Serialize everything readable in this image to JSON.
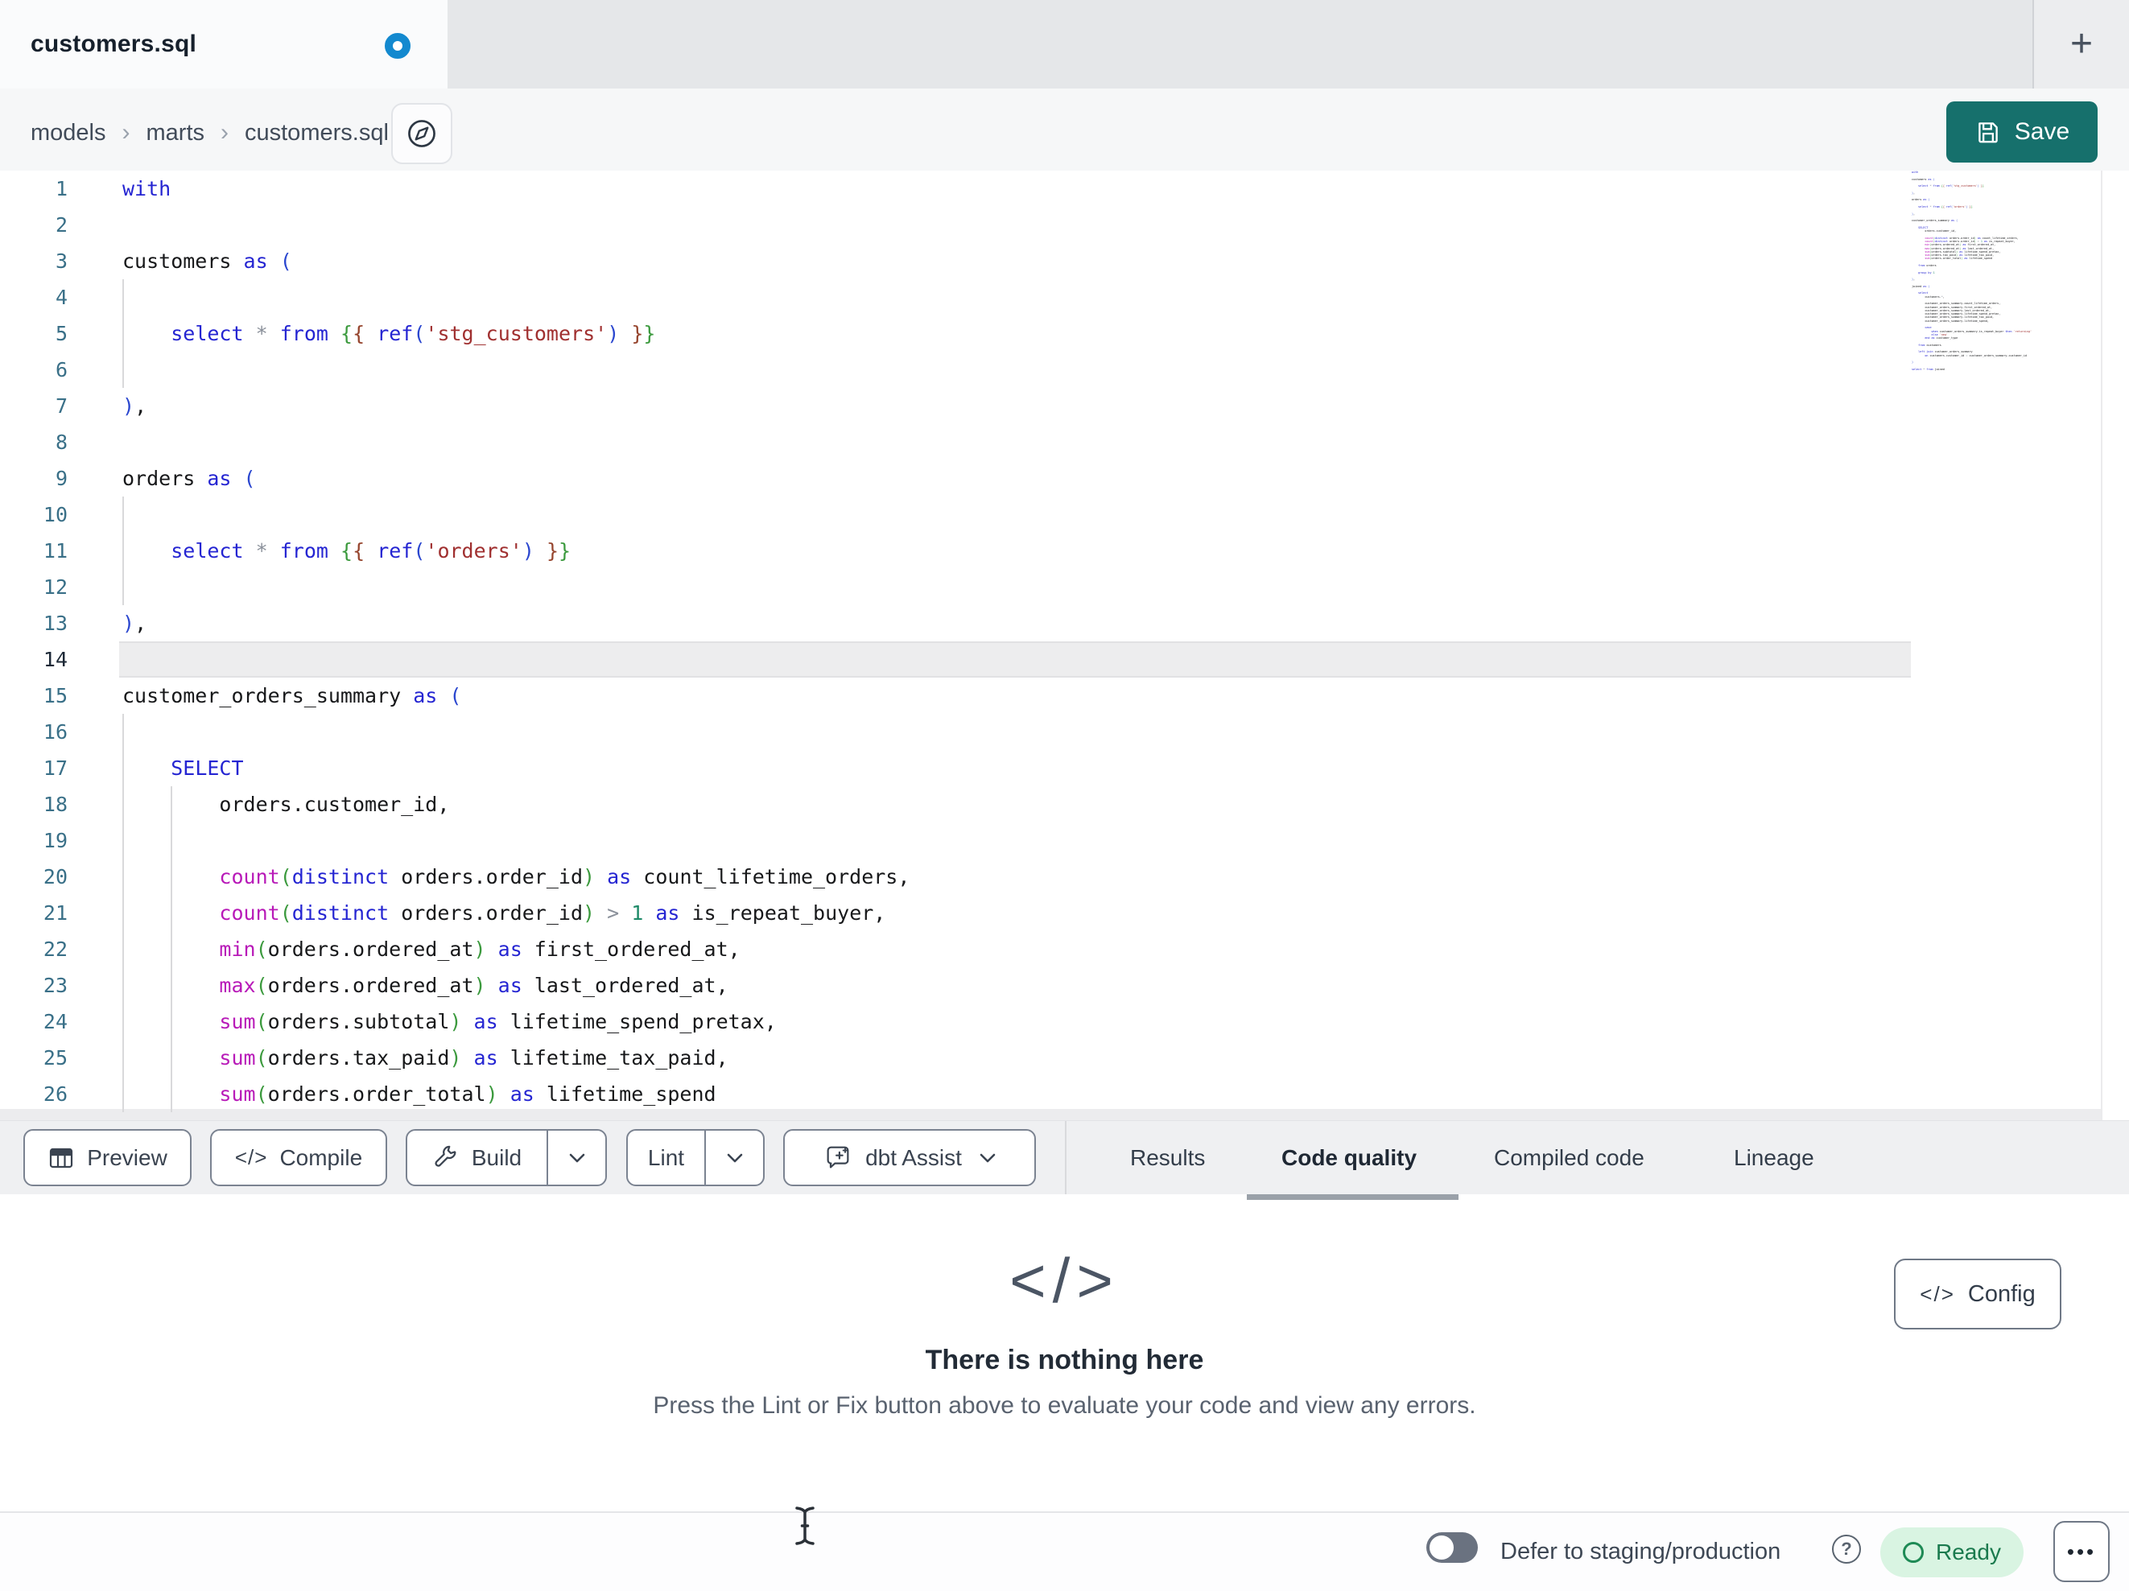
{
  "tab": {
    "title": "customers.sql"
  },
  "icons": {
    "plus": "+",
    "help": "?"
  },
  "breadcrumb": {
    "items": [
      "models",
      "marts",
      "customers.sql"
    ],
    "sep": "›"
  },
  "save": {
    "label": "Save"
  },
  "toolbar": {
    "preview_label": "Preview",
    "compile_label": "Compile",
    "build_label": "Build",
    "lint_label": "Lint",
    "assist_label": "dbt Assist"
  },
  "result_tabs": {
    "items": [
      "Results",
      "Code quality",
      "Compiled code",
      "Lineage"
    ],
    "active": "Code quality"
  },
  "empty": {
    "icon": "</>",
    "title": "There is nothing here",
    "subtitle": "Press the Lint or Fix button above to evaluate your code and view any errors."
  },
  "config": {
    "icon": "</>",
    "label": "Config"
  },
  "statusbar": {
    "defer_label": "Defer to staging/production",
    "ready_label": "Ready",
    "more": "•••"
  },
  "colors": {
    "save_teal": "#16706c",
    "unsaved_dot_blue": "#1389cf",
    "ready_bg": "#d9f4e2",
    "ready_text": "#1a7a4e",
    "active_tab_underline": "#9aa1a9",
    "keyword_blue": "#2525d2",
    "function_magenta": "#b81ab8",
    "string_maroon": "#a03030",
    "paren_green": "#3c9a3e",
    "number_teal": "#1e8a68"
  },
  "editor": {
    "active_line": 14,
    "lines": [
      {
        "n": 1,
        "g": [],
        "tk": [
          [
            "with",
            "k"
          ]
        ]
      },
      {
        "n": 2,
        "g": [],
        "tk": []
      },
      {
        "n": 3,
        "g": [],
        "tk": [
          [
            "customers ",
            "t"
          ],
          [
            "as",
            "k"
          ],
          [
            " ",
            "t"
          ],
          [
            "(",
            "p1"
          ]
        ]
      },
      {
        "n": 4,
        "g": [
          0
        ],
        "tk": []
      },
      {
        "n": 5,
        "g": [
          0
        ],
        "tk": [
          [
            "    ",
            "t"
          ],
          [
            "select",
            "k"
          ],
          [
            " ",
            "t"
          ],
          [
            "*",
            "o"
          ],
          [
            " ",
            "t"
          ],
          [
            "from",
            "k"
          ],
          [
            " ",
            "t"
          ],
          [
            "{",
            "jg"
          ],
          [
            "{",
            "jr"
          ],
          [
            " ",
            "t"
          ],
          [
            "ref",
            "k"
          ],
          [
            "(",
            "p1"
          ],
          [
            "'stg_customers'",
            "s"
          ],
          [
            ")",
            "p1"
          ],
          [
            " ",
            "t"
          ],
          [
            "}",
            "jr"
          ],
          [
            "}",
            "jg"
          ]
        ]
      },
      {
        "n": 6,
        "g": [
          0
        ],
        "tk": []
      },
      {
        "n": 7,
        "g": [],
        "tk": [
          [
            ")",
            "p1"
          ],
          [
            ",",
            "t"
          ]
        ]
      },
      {
        "n": 8,
        "g": [],
        "tk": []
      },
      {
        "n": 9,
        "g": [],
        "tk": [
          [
            "orders ",
            "t"
          ],
          [
            "as",
            "k"
          ],
          [
            " ",
            "t"
          ],
          [
            "(",
            "p1"
          ]
        ]
      },
      {
        "n": 10,
        "g": [
          0
        ],
        "tk": []
      },
      {
        "n": 11,
        "g": [
          0
        ],
        "tk": [
          [
            "    ",
            "t"
          ],
          [
            "select",
            "k"
          ],
          [
            " ",
            "t"
          ],
          [
            "*",
            "o"
          ],
          [
            " ",
            "t"
          ],
          [
            "from",
            "k"
          ],
          [
            " ",
            "t"
          ],
          [
            "{",
            "jg"
          ],
          [
            "{",
            "jr"
          ],
          [
            " ",
            "t"
          ],
          [
            "ref",
            "k"
          ],
          [
            "(",
            "p1"
          ],
          [
            "'orders'",
            "s"
          ],
          [
            ")",
            "p1"
          ],
          [
            " ",
            "t"
          ],
          [
            "}",
            "jr"
          ],
          [
            "}",
            "jg"
          ]
        ]
      },
      {
        "n": 12,
        "g": [
          0
        ],
        "tk": []
      },
      {
        "n": 13,
        "g": [],
        "tk": [
          [
            ")",
            "p1"
          ],
          [
            ",",
            "t"
          ]
        ]
      },
      {
        "n": 14,
        "g": [],
        "tk": []
      },
      {
        "n": 15,
        "g": [],
        "tk": [
          [
            "customer_orders_summary ",
            "t"
          ],
          [
            "as",
            "k"
          ],
          [
            " ",
            "t"
          ],
          [
            "(",
            "p1"
          ]
        ]
      },
      {
        "n": 16,
        "g": [
          0
        ],
        "tk": []
      },
      {
        "n": 17,
        "g": [
          0
        ],
        "tk": [
          [
            "    ",
            "t"
          ],
          [
            "SELECT",
            "k"
          ]
        ]
      },
      {
        "n": 18,
        "g": [
          0,
          1
        ],
        "tk": [
          [
            "        orders.customer_id,",
            "t"
          ]
        ]
      },
      {
        "n": 19,
        "g": [
          0,
          1
        ],
        "tk": []
      },
      {
        "n": 20,
        "g": [
          0,
          1
        ],
        "tk": [
          [
            "        ",
            "t"
          ],
          [
            "count",
            "fn"
          ],
          [
            "(",
            "p2"
          ],
          [
            "distinct",
            "k"
          ],
          [
            " orders.order_id",
            "t"
          ],
          [
            ")",
            "p2"
          ],
          [
            " ",
            "t"
          ],
          [
            "as",
            "k"
          ],
          [
            " count_lifetime_orders,",
            "t"
          ]
        ]
      },
      {
        "n": 21,
        "g": [
          0,
          1
        ],
        "tk": [
          [
            "        ",
            "t"
          ],
          [
            "count",
            "fn"
          ],
          [
            "(",
            "p2"
          ],
          [
            "distinct",
            "k"
          ],
          [
            " orders.order_id",
            "t"
          ],
          [
            ")",
            "p2"
          ],
          [
            " ",
            "t"
          ],
          [
            ">",
            "o"
          ],
          [
            " ",
            "t"
          ],
          [
            "1",
            "n"
          ],
          [
            " ",
            "t"
          ],
          [
            "as",
            "k"
          ],
          [
            " is_repeat_buyer,",
            "t"
          ]
        ]
      },
      {
        "n": 22,
        "g": [
          0,
          1
        ],
        "tk": [
          [
            "        ",
            "t"
          ],
          [
            "min",
            "fn"
          ],
          [
            "(",
            "p2"
          ],
          [
            "orders.ordered_at",
            "t"
          ],
          [
            ")",
            "p2"
          ],
          [
            " ",
            "t"
          ],
          [
            "as",
            "k"
          ],
          [
            " first_ordered_at,",
            "t"
          ]
        ]
      },
      {
        "n": 23,
        "g": [
          0,
          1
        ],
        "tk": [
          [
            "        ",
            "t"
          ],
          [
            "max",
            "fn"
          ],
          [
            "(",
            "p2"
          ],
          [
            "orders.ordered_at",
            "t"
          ],
          [
            ")",
            "p2"
          ],
          [
            " ",
            "t"
          ],
          [
            "as",
            "k"
          ],
          [
            " last_ordered_at,",
            "t"
          ]
        ]
      },
      {
        "n": 24,
        "g": [
          0,
          1
        ],
        "tk": [
          [
            "        ",
            "t"
          ],
          [
            "sum",
            "fn"
          ],
          [
            "(",
            "p2"
          ],
          [
            "orders.subtotal",
            "t"
          ],
          [
            ")",
            "p2"
          ],
          [
            " ",
            "t"
          ],
          [
            "as",
            "k"
          ],
          [
            " lifetime_spend_pretax,",
            "t"
          ]
        ]
      },
      {
        "n": 25,
        "g": [
          0,
          1
        ],
        "tk": [
          [
            "        ",
            "t"
          ],
          [
            "sum",
            "fn"
          ],
          [
            "(",
            "p2"
          ],
          [
            "orders.tax_paid",
            "t"
          ],
          [
            ")",
            "p2"
          ],
          [
            " ",
            "t"
          ],
          [
            "as",
            "k"
          ],
          [
            " lifetime_tax_paid,",
            "t"
          ]
        ]
      },
      {
        "n": 26,
        "g": [
          0,
          1
        ],
        "tk": [
          [
            "        ",
            "t"
          ],
          [
            "sum",
            "fn"
          ],
          [
            "(",
            "p2"
          ],
          [
            "orders.order_total",
            "t"
          ],
          [
            ")",
            "p2"
          ],
          [
            " ",
            "t"
          ],
          [
            "as",
            "k"
          ],
          [
            " lifetime_spend",
            "t"
          ]
        ]
      }
    ],
    "minimap_extra": [
      {
        "tk": []
      },
      {
        "tk": [
          [
            "    ",
            "t"
          ],
          [
            "from",
            "k"
          ],
          [
            " orders",
            "t"
          ]
        ]
      },
      {
        "tk": []
      },
      {
        "tk": [
          [
            "    ",
            "t"
          ],
          [
            "group by",
            "k"
          ],
          [
            " ",
            "t"
          ],
          [
            "1",
            "n"
          ]
        ]
      },
      {
        "tk": []
      },
      {
        "tk": [
          [
            ")",
            "p1"
          ],
          [
            ",",
            "t"
          ]
        ]
      },
      {
        "tk": []
      },
      {
        "tk": [
          [
            "joined ",
            "t"
          ],
          [
            "as",
            "k"
          ],
          [
            " ",
            "t"
          ],
          [
            "(",
            "p1"
          ]
        ]
      },
      {
        "tk": []
      },
      {
        "tk": [
          [
            "    ",
            "t"
          ],
          [
            "select",
            "k"
          ]
        ]
      },
      {
        "tk": [
          [
            "        customers.",
            "t"
          ],
          [
            "*",
            "o"
          ],
          [
            ",",
            "t"
          ]
        ]
      },
      {
        "tk": []
      },
      {
        "tk": [
          [
            "        customer_orders_summary.count_lifetime_orders,",
            "t"
          ]
        ]
      },
      {
        "tk": [
          [
            "        customer_orders_summary.first_ordered_at,",
            "t"
          ]
        ]
      },
      {
        "tk": [
          [
            "        customer_orders_summary.last_ordered_at,",
            "t"
          ]
        ]
      },
      {
        "tk": [
          [
            "        customer_orders_summary.lifetime_spend_pretax,",
            "t"
          ]
        ]
      },
      {
        "tk": [
          [
            "        customer_orders_summary.lifetime_tax_paid,",
            "t"
          ]
        ]
      },
      {
        "tk": [
          [
            "        customer_orders_summary.lifetime_spend,",
            "t"
          ]
        ]
      },
      {
        "tk": []
      },
      {
        "tk": [
          [
            "        ",
            "t"
          ],
          [
            "case",
            "k"
          ]
        ]
      },
      {
        "tk": [
          [
            "            ",
            "t"
          ],
          [
            "when",
            "k"
          ],
          [
            " customer_orders_summary.is_repeat_buyer ",
            "t"
          ],
          [
            "then",
            "k"
          ],
          [
            " ",
            "t"
          ],
          [
            "'returning'",
            "s"
          ]
        ]
      },
      {
        "tk": [
          [
            "            ",
            "t"
          ],
          [
            "else",
            "k"
          ],
          [
            " ",
            "t"
          ],
          [
            "'new'",
            "s"
          ]
        ]
      },
      {
        "tk": [
          [
            "        ",
            "t"
          ],
          [
            "end",
            "k"
          ],
          [
            " ",
            "t"
          ],
          [
            "as",
            "k"
          ],
          [
            " customer_type",
            "t"
          ]
        ]
      },
      {
        "tk": []
      },
      {
        "tk": [
          [
            "    ",
            "t"
          ],
          [
            "from",
            "k"
          ],
          [
            " customers",
            "t"
          ]
        ]
      },
      {
        "tk": []
      },
      {
        "tk": [
          [
            "    ",
            "t"
          ],
          [
            "left join",
            "k"
          ],
          [
            " customer_orders_summary",
            "t"
          ]
        ]
      },
      {
        "tk": [
          [
            "        ",
            "t"
          ],
          [
            "on",
            "k"
          ],
          [
            " customers.customer_id ",
            "t"
          ],
          [
            "=",
            "o"
          ],
          [
            " customer_orders_summary.customer_id",
            "t"
          ]
        ]
      },
      {
        "tk": []
      },
      {
        "tk": [
          [
            ")",
            "p1"
          ]
        ]
      },
      {
        "tk": []
      },
      {
        "tk": [
          [
            "select",
            "k"
          ],
          [
            " ",
            "t"
          ],
          [
            "*",
            "o"
          ],
          [
            " ",
            "t"
          ],
          [
            "from",
            "k"
          ],
          [
            " joined",
            "t"
          ]
        ]
      }
    ]
  }
}
